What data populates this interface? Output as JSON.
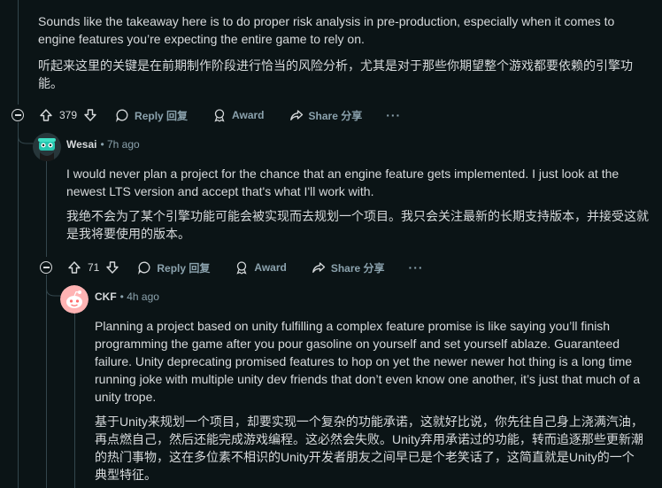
{
  "comment1": {
    "text_en": "Sounds like the takeaway here is to do proper risk analysis in pre-production, especially when it comes to engine features you’re expecting the entire game to rely on.",
    "text_zh": "听起来这里的关键是在前期制作阶段进行恰当的风险分析，尤其是对于那些你期望整个游戏都要依赖的引擎功能。",
    "votes": "379",
    "reply": "Reply 回复",
    "award": "Award",
    "share": "Share 分享",
    "more": "···"
  },
  "comment2": {
    "author": "Wesai",
    "time": "• 7h ago",
    "text_en": "I would never plan a project for the chance that an engine feature gets implemented. I just look at the newest LTS version and accept that's what I'll work with.",
    "text_zh": "我绝不会为了某个引擎功能可能会被实现而去规划一个项目。我只会关注最新的长期支持版本，并接受这就是我将要使用的版本。",
    "votes": "71",
    "reply": "Reply 回复",
    "award": "Award",
    "share": "Share 分享",
    "more": "···"
  },
  "comment3": {
    "author": "CKF",
    "time": "• 4h ago",
    "text_en": "Planning a project based on unity fulfilling a complex feature promise is like saying you’ll finish programming the game after you pour gasoline on yourself and set yourself ablaze. Guaranteed failure. Unity deprecating promised features to hop on yet the newer newer hot thing is a long time running joke with multiple unity dev friends that don’t even know one another, it’s just that much of a unity trope.",
    "text_zh": "基于Unity来规划一个项目，却要实现一个复杂的功能承诺，这就好比说，你先往自己身上浇满汽油，再点燃自己，然后还能完成游戏编程。这必然会失败。Unity弃用承诺过的功能，转而追逐那些更新潮的热门事物，这在多位素不相识的Unity开发者朋友之间早已是个老笑话了，这简直就是Unity的一个典型特征。"
  },
  "colors": {
    "background": "#0b1416",
    "text": "#d7dadc",
    "meta": "#8ba2ad",
    "thread": "#33464c"
  },
  "icons": [
    "collapse-icon",
    "upvote-icon",
    "downvote-icon",
    "reply-icon",
    "award-icon",
    "share-icon",
    "more-options-icon"
  ]
}
